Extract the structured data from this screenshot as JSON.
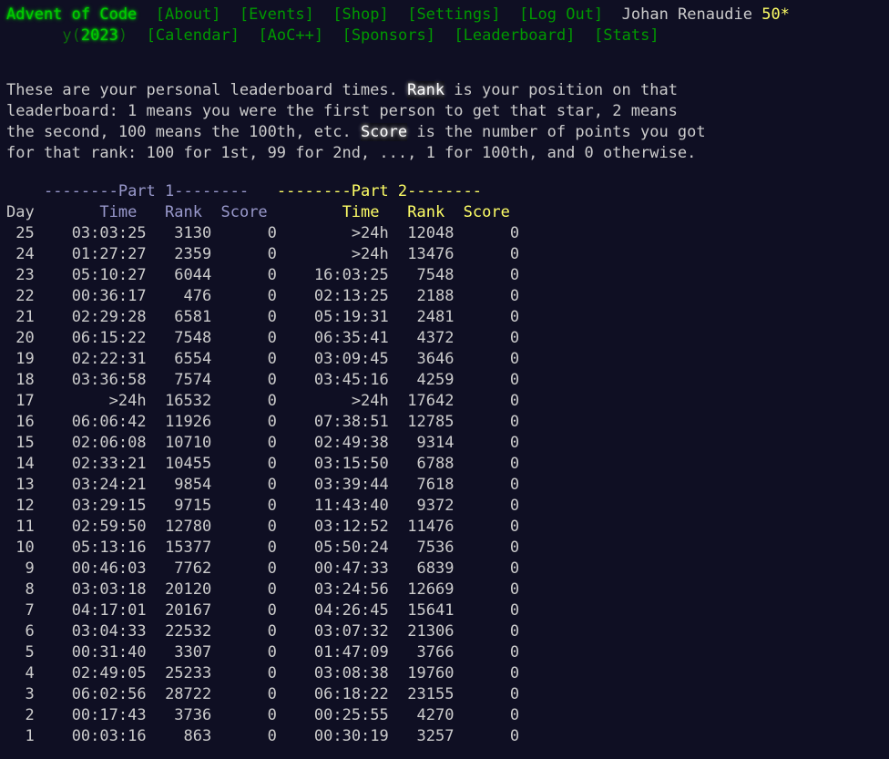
{
  "header": {
    "title": "Advent of Code",
    "year_prefix": "y(",
    "year": "2023",
    "year_suffix": ")",
    "nav_top": [
      "[About]",
      "[Events]",
      "[Shop]",
      "[Settings]",
      "[Log Out]"
    ],
    "nav_bottom": [
      "[Calendar]",
      "[AoC++]",
      "[Sponsors]",
      "[Leaderboard]",
      "[Stats]"
    ],
    "user": "Johan Renaudie",
    "stars": "50*"
  },
  "intro": {
    "line1_a": "These are your personal leaderboard times. ",
    "rank_word": "Rank",
    "line1_b": " is your position on that",
    "line2": "leaderboard: 1 means you were the first person to get that star, 2 means",
    "line3_a": "the second, 100 means the 100th, etc. ",
    "score_word": "Score",
    "line3_b": " is the number of points you got",
    "line4": "for that rank: 100 for 1st, 99 for 2nd, ..., 1 for 100th, and 0 otherwise."
  },
  "table": {
    "part1_header": "--------Part 1--------",
    "part2_header": "--------Part 2--------",
    "col_day": "Day",
    "col_time": "Time",
    "col_rank": "Rank",
    "col_score": "Score",
    "rows": [
      {
        "day": "25",
        "t1": "03:03:25",
        "r1": "3130",
        "s1": "0",
        "t2": ">24h",
        "r2": "12048",
        "s2": "0"
      },
      {
        "day": "24",
        "t1": "01:27:27",
        "r1": "2359",
        "s1": "0",
        "t2": ">24h",
        "r2": "13476",
        "s2": "0"
      },
      {
        "day": "23",
        "t1": "05:10:27",
        "r1": "6044",
        "s1": "0",
        "t2": "16:03:25",
        "r2": "7548",
        "s2": "0"
      },
      {
        "day": "22",
        "t1": "00:36:17",
        "r1": "476",
        "s1": "0",
        "t2": "02:13:25",
        "r2": "2188",
        "s2": "0"
      },
      {
        "day": "21",
        "t1": "02:29:28",
        "r1": "6581",
        "s1": "0",
        "t2": "05:19:31",
        "r2": "2481",
        "s2": "0"
      },
      {
        "day": "20",
        "t1": "06:15:22",
        "r1": "7548",
        "s1": "0",
        "t2": "06:35:41",
        "r2": "4372",
        "s2": "0"
      },
      {
        "day": "19",
        "t1": "02:22:31",
        "r1": "6554",
        "s1": "0",
        "t2": "03:09:45",
        "r2": "3646",
        "s2": "0"
      },
      {
        "day": "18",
        "t1": "03:36:58",
        "r1": "7574",
        "s1": "0",
        "t2": "03:45:16",
        "r2": "4259",
        "s2": "0"
      },
      {
        "day": "17",
        "t1": ">24h",
        "r1": "16532",
        "s1": "0",
        "t2": ">24h",
        "r2": "17642",
        "s2": "0"
      },
      {
        "day": "16",
        "t1": "06:06:42",
        "r1": "11926",
        "s1": "0",
        "t2": "07:38:51",
        "r2": "12785",
        "s2": "0"
      },
      {
        "day": "15",
        "t1": "02:06:08",
        "r1": "10710",
        "s1": "0",
        "t2": "02:49:38",
        "r2": "9314",
        "s2": "0"
      },
      {
        "day": "14",
        "t1": "02:33:21",
        "r1": "10455",
        "s1": "0",
        "t2": "03:15:50",
        "r2": "6788",
        "s2": "0"
      },
      {
        "day": "13",
        "t1": "03:24:21",
        "r1": "9854",
        "s1": "0",
        "t2": "03:39:44",
        "r2": "7618",
        "s2": "0"
      },
      {
        "day": "12",
        "t1": "03:29:15",
        "r1": "9715",
        "s1": "0",
        "t2": "11:43:40",
        "r2": "9372",
        "s2": "0"
      },
      {
        "day": "11",
        "t1": "02:59:50",
        "r1": "12780",
        "s1": "0",
        "t2": "03:12:52",
        "r2": "11476",
        "s2": "0"
      },
      {
        "day": "10",
        "t1": "05:13:16",
        "r1": "15377",
        "s1": "0",
        "t2": "05:50:24",
        "r2": "7536",
        "s2": "0"
      },
      {
        "day": "9",
        "t1": "00:46:03",
        "r1": "7762",
        "s1": "0",
        "t2": "00:47:33",
        "r2": "6839",
        "s2": "0"
      },
      {
        "day": "8",
        "t1": "03:03:18",
        "r1": "20120",
        "s1": "0",
        "t2": "03:24:56",
        "r2": "12669",
        "s2": "0"
      },
      {
        "day": "7",
        "t1": "04:17:01",
        "r1": "20167",
        "s1": "0",
        "t2": "04:26:45",
        "r2": "15641",
        "s2": "0"
      },
      {
        "day": "6",
        "t1": "03:04:33",
        "r1": "22532",
        "s1": "0",
        "t2": "03:07:32",
        "r2": "21306",
        "s2": "0"
      },
      {
        "day": "5",
        "t1": "00:31:40",
        "r1": "3307",
        "s1": "0",
        "t2": "01:47:09",
        "r2": "3766",
        "s2": "0"
      },
      {
        "day": "4",
        "t1": "02:49:05",
        "r1": "25233",
        "s1": "0",
        "t2": "03:08:38",
        "r2": "19760",
        "s2": "0"
      },
      {
        "day": "3",
        "t1": "06:02:56",
        "r1": "28722",
        "s1": "0",
        "t2": "06:18:22",
        "r2": "23155",
        "s2": "0"
      },
      {
        "day": "2",
        "t1": "00:17:43",
        "r1": "3736",
        "s1": "0",
        "t2": "00:25:55",
        "r2": "4270",
        "s2": "0"
      },
      {
        "day": "1",
        "t1": "00:03:16",
        "r1": "863",
        "s1": "0",
        "t2": "00:30:19",
        "r2": "3257",
        "s2": "0"
      }
    ]
  },
  "colors": {
    "background": "#0f0f23",
    "text": "#cccccc",
    "link_green": "#009900",
    "title_green": "#00cc00",
    "stars_yellow": "#ffff66",
    "part1_color": "#9999cc",
    "part2_color": "#ffff66"
  }
}
